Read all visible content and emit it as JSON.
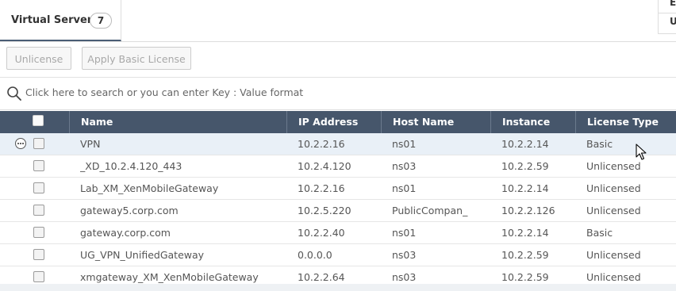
{
  "tabs": [
    {
      "label": "Virtual Servers",
      "count": "7"
    }
  ],
  "corner": {
    "line1": "E",
    "line2": "U"
  },
  "toolbar": {
    "unlicense_label": "Unlicense",
    "apply_basic_label": "Apply Basic License"
  },
  "search": {
    "placeholder": "Click here to search or you can enter Key : Value format"
  },
  "table": {
    "columns": [
      "Name",
      "IP Address",
      "Host Name",
      "Instance",
      "License Type"
    ],
    "rows": [
      {
        "name": "VPN",
        "ip": "10.2.2.16",
        "host": "ns01",
        "instance": "10.2.2.14",
        "license": "Basic"
      },
      {
        "name": "_XD_10.2.4.120_443",
        "ip": "10.2.4.120",
        "host": "ns03",
        "instance": "10.2.2.59",
        "license": "Unlicensed"
      },
      {
        "name": "Lab_XM_XenMobileGateway",
        "ip": "10.2.2.16",
        "host": "ns01",
        "instance": "10.2.2.14",
        "license": "Unlicensed"
      },
      {
        "name": "gateway5.corp.com",
        "ip": "10.2.5.220",
        "host": "PublicCompan_",
        "instance": "10.2.2.126",
        "license": "Unlicensed"
      },
      {
        "name": "gateway.corp.com",
        "ip": "10.2.2.40",
        "host": "ns01",
        "instance": "10.2.2.14",
        "license": "Basic"
      },
      {
        "name": "UG_VPN_UnifiedGateway",
        "ip": "0.0.0.0",
        "host": "ns03",
        "instance": "10.2.2.59",
        "license": "Unlicensed"
      },
      {
        "name": "xmgateway_XM_XenMobileGateway",
        "ip": "10.2.2.64",
        "host": "ns03",
        "instance": "10.2.2.59",
        "license": "Unlicensed"
      }
    ]
  },
  "colors": {
    "header_bg": "#46566b",
    "selected_row_bg": "#e9f0f7",
    "tab_accent": "#4a5d75"
  },
  "icons": {
    "search": "search-icon",
    "more": "more-options-icon",
    "cursor": "mouse-pointer-icon"
  }
}
